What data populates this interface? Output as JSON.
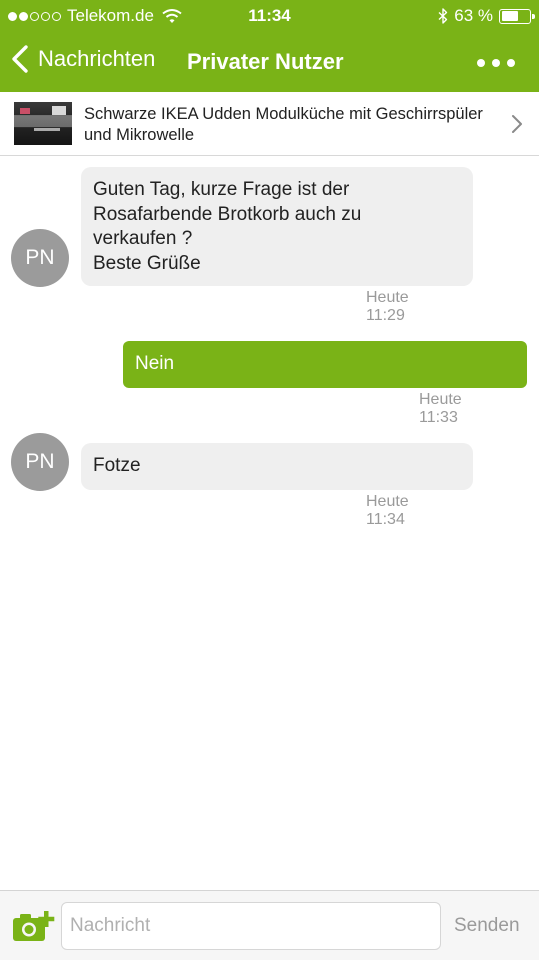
{
  "status_bar": {
    "carrier": "Telekom.de",
    "time": "11:34",
    "battery_percent": "63 %",
    "battery_level": 0.63,
    "signal_bars_filled": 2,
    "signal_bars_total": 5
  },
  "nav": {
    "back_label": "Nachrichten",
    "title": "Privater Nutzer"
  },
  "listing": {
    "title": "Schwarze IKEA Udden Modulküche mit Geschirrspüler und Mikrowelle"
  },
  "messages": [
    {
      "direction": "incoming",
      "avatar": "PN",
      "text": "Guten Tag, kurze Frage ist der\nRosafarbende Brotkorb auch zu\nverkaufen ?\nBeste Grüße",
      "time": "Heute 11:29"
    },
    {
      "direction": "outgoing",
      "text": "Nein",
      "time": "Heute 11:33"
    },
    {
      "direction": "incoming",
      "avatar": "PN",
      "text": "Fotze",
      "time": "Heute 11:34"
    }
  ],
  "composer": {
    "placeholder": "Nachricht",
    "send_label": "Senden",
    "camera_icon": "camera-add-icon"
  },
  "colors": {
    "accent": "#7ab317",
    "incoming_bubble": "#efefef",
    "avatar": "#9b9b9b",
    "timestamp": "#9a9a9a"
  }
}
